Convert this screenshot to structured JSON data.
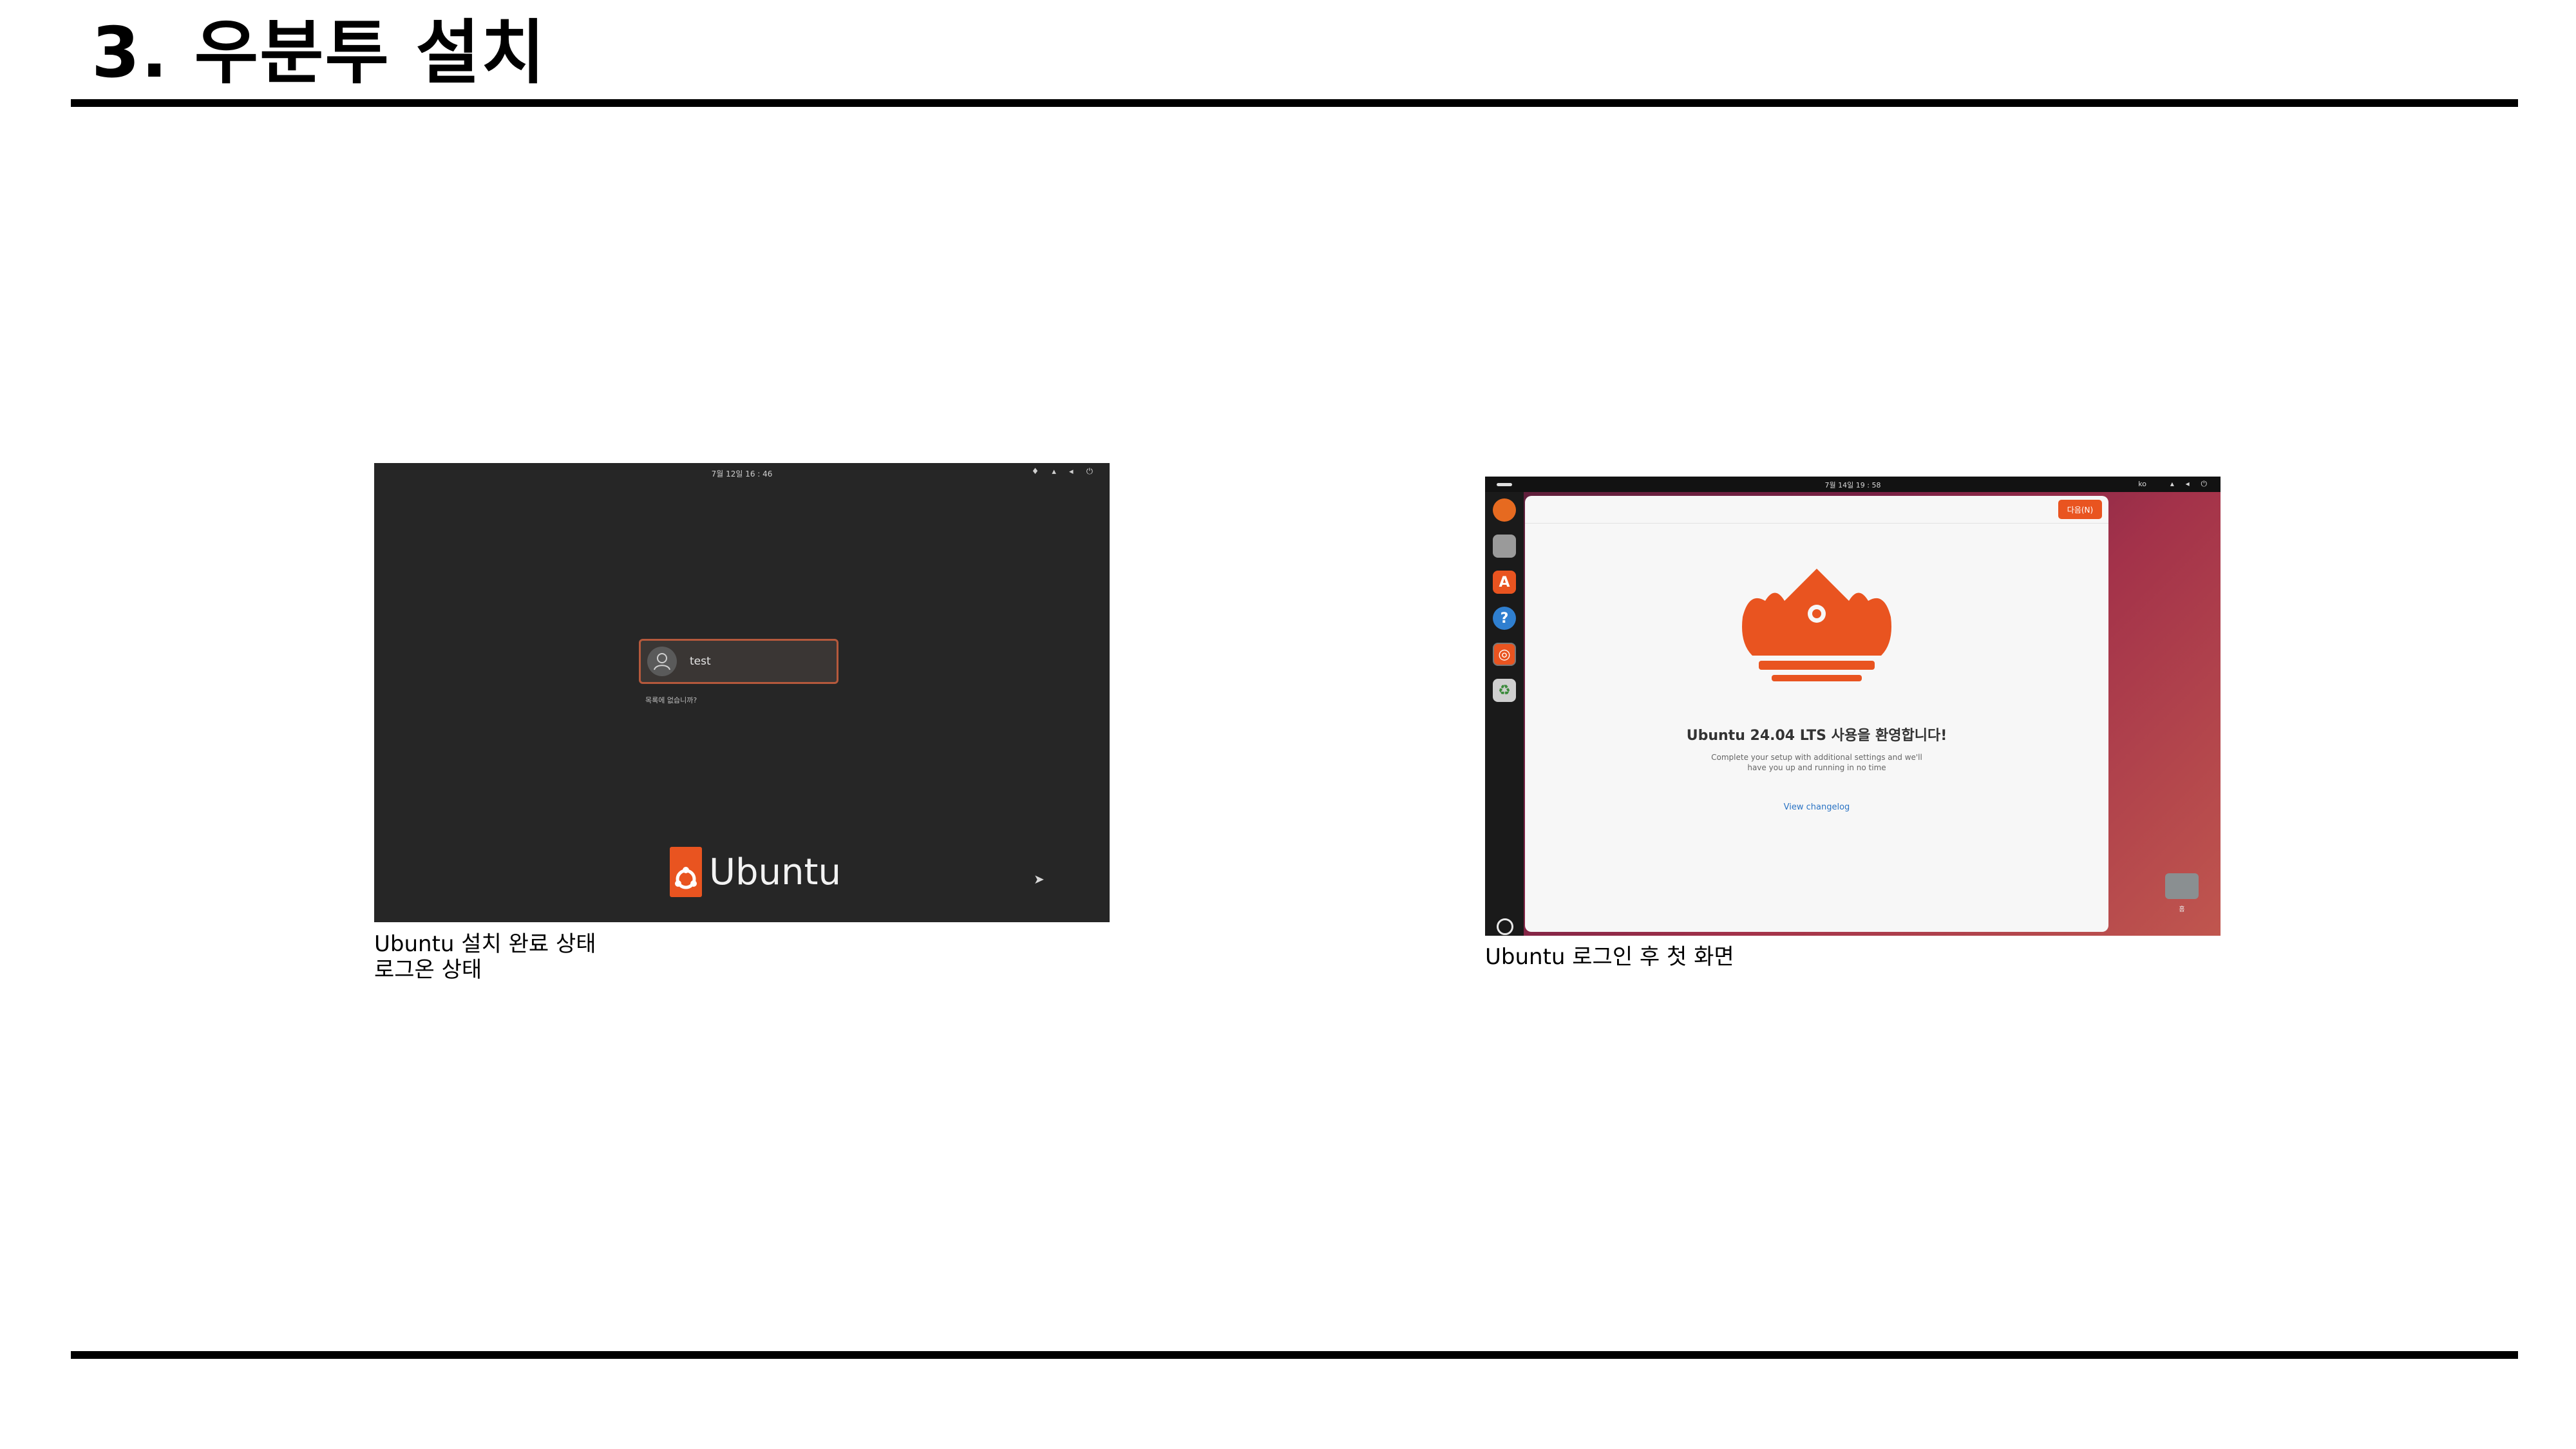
{
  "slide": {
    "title": "3. 우분투 설치"
  },
  "screenshot_login": {
    "clock": "7월 12일 16 : 46",
    "user_name": "test",
    "not_listed": "목록에 없습니까?",
    "brand": "Ubuntu",
    "caption_line1": "Ubuntu 설치 완료 상태",
    "caption_line2": "로그온 상태",
    "colors": {
      "background": "#262626",
      "accent": "#e95420"
    }
  },
  "screenshot_welcome": {
    "clock": "7월 14일 19 : 58",
    "language": "ko",
    "next_button": "다음(N)",
    "welcome_title": "Ubuntu 24.04 LTS 사용을 환영합니다!",
    "subtitle_line1": "Complete your setup with additional settings and we'll",
    "subtitle_line2": "have you up and running in no time",
    "changelog_link": "View changelog",
    "home_label": "홈",
    "caption": "Ubuntu 로그인 후 첫 화면",
    "dock_icons": [
      "firefox-icon",
      "files-icon",
      "app-center-icon",
      "help-icon",
      "ubuntu-installer-icon",
      "trash-icon"
    ],
    "colors": {
      "accent": "#e95420",
      "dock": "#1a1a1a",
      "window": "#f7f7f7"
    }
  }
}
